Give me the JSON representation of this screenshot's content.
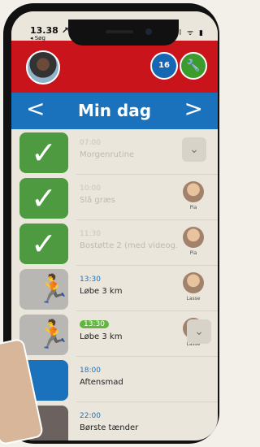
{
  "status": {
    "time": "13.38 ↗",
    "back": "◂ Søg",
    "icons": "ııl ᯤ ▮"
  },
  "header": {
    "calendar_label": "16",
    "tool_icon": "wrench-icon"
  },
  "nav": {
    "title": "Min dag",
    "prev": "<",
    "next": ">"
  },
  "items": [
    {
      "time": "07:00",
      "title": "Morgenrutine",
      "state": "done"
    },
    {
      "time": "10:00",
      "title": "Slå græs",
      "state": "done",
      "person": "Pia"
    },
    {
      "time": "11:30",
      "title": "Bostøtte 2 (med videog...",
      "state": "done",
      "person": "Pia"
    },
    {
      "time": "13:30",
      "title": "Løbe 3 km",
      "state": "active",
      "person": "Lasse"
    },
    {
      "time": "13:30",
      "title": "Løbe 3 km",
      "state": "active",
      "person": "Lasse"
    },
    {
      "time": "18:00",
      "title": "Aftensmad",
      "state": "upcoming"
    },
    {
      "time": "22:00",
      "title": "Børste tænder",
      "state": "upcoming"
    }
  ]
}
